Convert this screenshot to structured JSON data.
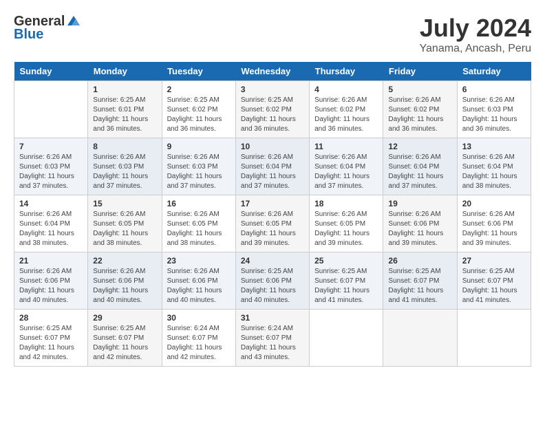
{
  "header": {
    "logo_line1": "General",
    "logo_line2": "Blue",
    "month": "July 2024",
    "location": "Yanama, Ancash, Peru"
  },
  "weekdays": [
    "Sunday",
    "Monday",
    "Tuesday",
    "Wednesday",
    "Thursday",
    "Friday",
    "Saturday"
  ],
  "weeks": [
    [
      {
        "day": "",
        "sunrise": "",
        "sunset": "",
        "daylight": ""
      },
      {
        "day": "1",
        "sunrise": "Sunrise: 6:25 AM",
        "sunset": "Sunset: 6:01 PM",
        "daylight": "Daylight: 11 hours and 36 minutes."
      },
      {
        "day": "2",
        "sunrise": "Sunrise: 6:25 AM",
        "sunset": "Sunset: 6:02 PM",
        "daylight": "Daylight: 11 hours and 36 minutes."
      },
      {
        "day": "3",
        "sunrise": "Sunrise: 6:25 AM",
        "sunset": "Sunset: 6:02 PM",
        "daylight": "Daylight: 11 hours and 36 minutes."
      },
      {
        "day": "4",
        "sunrise": "Sunrise: 6:26 AM",
        "sunset": "Sunset: 6:02 PM",
        "daylight": "Daylight: 11 hours and 36 minutes."
      },
      {
        "day": "5",
        "sunrise": "Sunrise: 6:26 AM",
        "sunset": "Sunset: 6:02 PM",
        "daylight": "Daylight: 11 hours and 36 minutes."
      },
      {
        "day": "6",
        "sunrise": "Sunrise: 6:26 AM",
        "sunset": "Sunset: 6:03 PM",
        "daylight": "Daylight: 11 hours and 36 minutes."
      }
    ],
    [
      {
        "day": "7",
        "sunrise": "Sunrise: 6:26 AM",
        "sunset": "Sunset: 6:03 PM",
        "daylight": "Daylight: 11 hours and 37 minutes."
      },
      {
        "day": "8",
        "sunrise": "Sunrise: 6:26 AM",
        "sunset": "Sunset: 6:03 PM",
        "daylight": "Daylight: 11 hours and 37 minutes."
      },
      {
        "day": "9",
        "sunrise": "Sunrise: 6:26 AM",
        "sunset": "Sunset: 6:03 PM",
        "daylight": "Daylight: 11 hours and 37 minutes."
      },
      {
        "day": "10",
        "sunrise": "Sunrise: 6:26 AM",
        "sunset": "Sunset: 6:04 PM",
        "daylight": "Daylight: 11 hours and 37 minutes."
      },
      {
        "day": "11",
        "sunrise": "Sunrise: 6:26 AM",
        "sunset": "Sunset: 6:04 PM",
        "daylight": "Daylight: 11 hours and 37 minutes."
      },
      {
        "day": "12",
        "sunrise": "Sunrise: 6:26 AM",
        "sunset": "Sunset: 6:04 PM",
        "daylight": "Daylight: 11 hours and 37 minutes."
      },
      {
        "day": "13",
        "sunrise": "Sunrise: 6:26 AM",
        "sunset": "Sunset: 6:04 PM",
        "daylight": "Daylight: 11 hours and 38 minutes."
      }
    ],
    [
      {
        "day": "14",
        "sunrise": "Sunrise: 6:26 AM",
        "sunset": "Sunset: 6:04 PM",
        "daylight": "Daylight: 11 hours and 38 minutes."
      },
      {
        "day": "15",
        "sunrise": "Sunrise: 6:26 AM",
        "sunset": "Sunset: 6:05 PM",
        "daylight": "Daylight: 11 hours and 38 minutes."
      },
      {
        "day": "16",
        "sunrise": "Sunrise: 6:26 AM",
        "sunset": "Sunset: 6:05 PM",
        "daylight": "Daylight: 11 hours and 38 minutes."
      },
      {
        "day": "17",
        "sunrise": "Sunrise: 6:26 AM",
        "sunset": "Sunset: 6:05 PM",
        "daylight": "Daylight: 11 hours and 39 minutes."
      },
      {
        "day": "18",
        "sunrise": "Sunrise: 6:26 AM",
        "sunset": "Sunset: 6:05 PM",
        "daylight": "Daylight: 11 hours and 39 minutes."
      },
      {
        "day": "19",
        "sunrise": "Sunrise: 6:26 AM",
        "sunset": "Sunset: 6:06 PM",
        "daylight": "Daylight: 11 hours and 39 minutes."
      },
      {
        "day": "20",
        "sunrise": "Sunrise: 6:26 AM",
        "sunset": "Sunset: 6:06 PM",
        "daylight": "Daylight: 11 hours and 39 minutes."
      }
    ],
    [
      {
        "day": "21",
        "sunrise": "Sunrise: 6:26 AM",
        "sunset": "Sunset: 6:06 PM",
        "daylight": "Daylight: 11 hours and 40 minutes."
      },
      {
        "day": "22",
        "sunrise": "Sunrise: 6:26 AM",
        "sunset": "Sunset: 6:06 PM",
        "daylight": "Daylight: 11 hours and 40 minutes."
      },
      {
        "day": "23",
        "sunrise": "Sunrise: 6:26 AM",
        "sunset": "Sunset: 6:06 PM",
        "daylight": "Daylight: 11 hours and 40 minutes."
      },
      {
        "day": "24",
        "sunrise": "Sunrise: 6:25 AM",
        "sunset": "Sunset: 6:06 PM",
        "daylight": "Daylight: 11 hours and 40 minutes."
      },
      {
        "day": "25",
        "sunrise": "Sunrise: 6:25 AM",
        "sunset": "Sunset: 6:07 PM",
        "daylight": "Daylight: 11 hours and 41 minutes."
      },
      {
        "day": "26",
        "sunrise": "Sunrise: 6:25 AM",
        "sunset": "Sunset: 6:07 PM",
        "daylight": "Daylight: 11 hours and 41 minutes."
      },
      {
        "day": "27",
        "sunrise": "Sunrise: 6:25 AM",
        "sunset": "Sunset: 6:07 PM",
        "daylight": "Daylight: 11 hours and 41 minutes."
      }
    ],
    [
      {
        "day": "28",
        "sunrise": "Sunrise: 6:25 AM",
        "sunset": "Sunset: 6:07 PM",
        "daylight": "Daylight: 11 hours and 42 minutes."
      },
      {
        "day": "29",
        "sunrise": "Sunrise: 6:25 AM",
        "sunset": "Sunset: 6:07 PM",
        "daylight": "Daylight: 11 hours and 42 minutes."
      },
      {
        "day": "30",
        "sunrise": "Sunrise: 6:24 AM",
        "sunset": "Sunset: 6:07 PM",
        "daylight": "Daylight: 11 hours and 42 minutes."
      },
      {
        "day": "31",
        "sunrise": "Sunrise: 6:24 AM",
        "sunset": "Sunset: 6:07 PM",
        "daylight": "Daylight: 11 hours and 43 minutes."
      },
      {
        "day": "",
        "sunrise": "",
        "sunset": "",
        "daylight": ""
      },
      {
        "day": "",
        "sunrise": "",
        "sunset": "",
        "daylight": ""
      },
      {
        "day": "",
        "sunrise": "",
        "sunset": "",
        "daylight": ""
      }
    ]
  ]
}
